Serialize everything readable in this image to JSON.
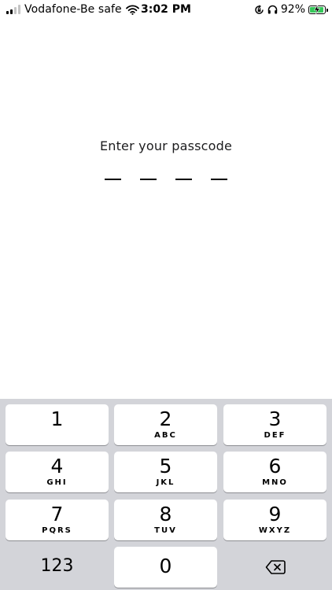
{
  "status_bar": {
    "carrier": "Vodafone-Be safe",
    "time": "3:02 PM",
    "battery_percent": "92%",
    "battery_level": 0.92,
    "battery_color": "#34c759",
    "icons": [
      "signal-icon",
      "wifi-icon",
      "orientation-lock-icon",
      "headphones-icon",
      "battery-icon",
      "charging-bolt-icon"
    ]
  },
  "passcode": {
    "prompt": "Enter your passcode",
    "digits_total": 4,
    "digits_entered": 0
  },
  "keypad": {
    "keys": [
      {
        "digit": "1",
        "letters": ""
      },
      {
        "digit": "2",
        "letters": "ABC"
      },
      {
        "digit": "3",
        "letters": "DEF"
      },
      {
        "digit": "4",
        "letters": "GHI"
      },
      {
        "digit": "5",
        "letters": "JKL"
      },
      {
        "digit": "6",
        "letters": "MNO"
      },
      {
        "digit": "7",
        "letters": "PQRS"
      },
      {
        "digit": "8",
        "letters": "TUV"
      },
      {
        "digit": "9",
        "letters": "WXYZ"
      },
      {
        "digit": "0",
        "letters": ""
      }
    ],
    "mode_key_label": "123",
    "delete_icon": "delete-backspace-icon",
    "background_color": "#d3d4d9"
  }
}
